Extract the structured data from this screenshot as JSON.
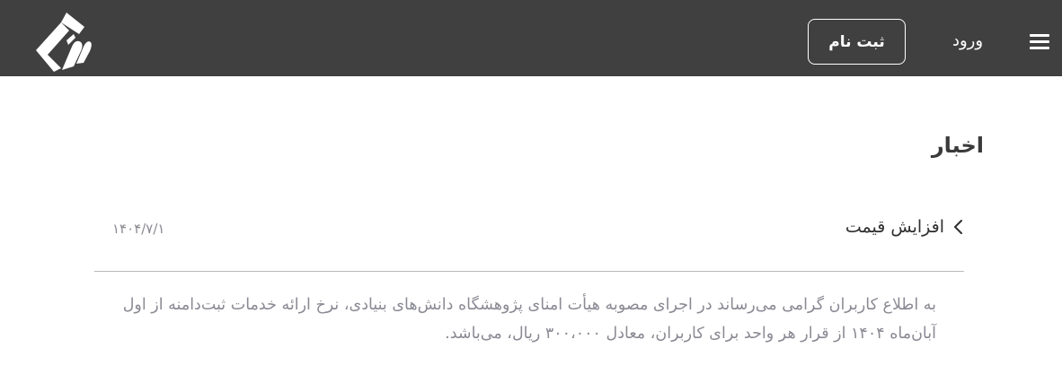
{
  "header": {
    "logo_icon": "site-logo-icon",
    "register_label": "ثبت نام",
    "login_label": "ورود",
    "menu_icon": "hamburger-menu-icon",
    "background_color": "#404040"
  },
  "main": {
    "title": "اخبار",
    "news": [
      {
        "title": "افزایش قیمت",
        "date": "۱۴۰۴/۷/۱",
        "chevron_icon": "chevron-left-icon",
        "body": "به اطلاع کاربران گرامی می‌رساند در اجرای مصوبه هیأت امنای پژوهشگاه دانش‌های بنیادی، نرخ ارائه خدمات ثبت‌دامنه از اول آبان‌ماه ۱۴۰۴ از قرار هر واحد برای کاربران، معادل ۳۰۰،۰۰۰ ریال، می‌باشد."
      }
    ]
  }
}
